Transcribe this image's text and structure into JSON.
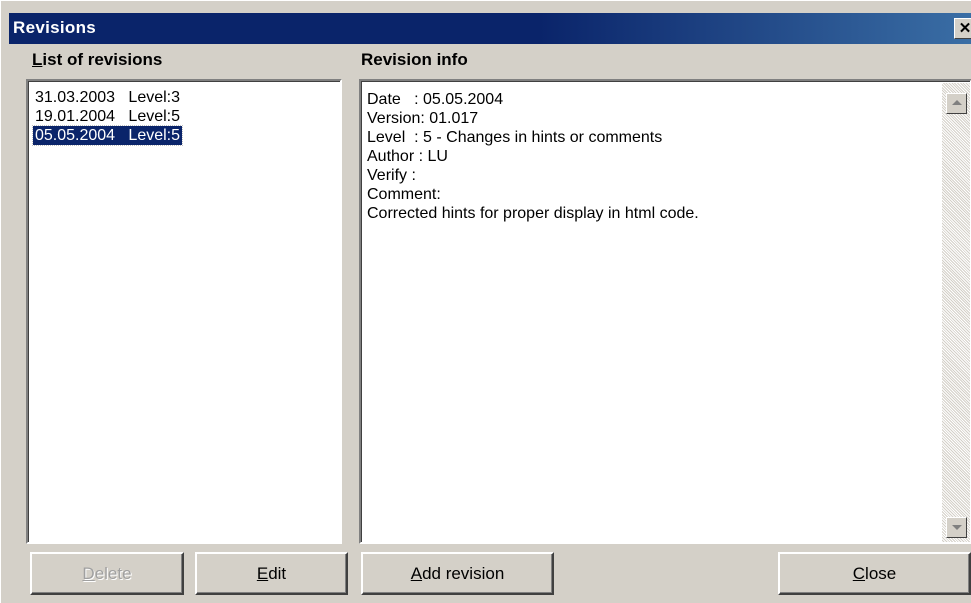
{
  "window": {
    "title": "Revisions",
    "close_glyph": "✕"
  },
  "list_panel": {
    "label_mnemonic": "L",
    "label_rest": "ist of revisions",
    "items": [
      {
        "text": "31.03.2003   Level:3",
        "selected": false
      },
      {
        "text": "19.01.2004   Level:5",
        "selected": false
      },
      {
        "text": "05.05.2004   Level:5",
        "selected": true
      }
    ]
  },
  "info_panel": {
    "label": "Revision info",
    "lines": [
      "Date   : 05.05.2004",
      "Version: 01.017",
      "Level  : 5 - Changes in hints or comments",
      "Author : LU",
      "Verify :",
      "Comment:",
      "Corrected hints for proper display in html code."
    ]
  },
  "buttons": {
    "delete": {
      "mnemonic": "D",
      "rest": "elete",
      "enabled": false
    },
    "edit": {
      "mnemonic": "E",
      "rest": "dit",
      "enabled": true
    },
    "add_revision": {
      "mnemonic": "A",
      "rest": "dd revision",
      "enabled": true
    },
    "close": {
      "mnemonic": "C",
      "rest": "lose",
      "enabled": true
    }
  },
  "colors": {
    "titlebar": "#0a246a",
    "selection": "#0a246a",
    "face": "#d4d0c8"
  }
}
